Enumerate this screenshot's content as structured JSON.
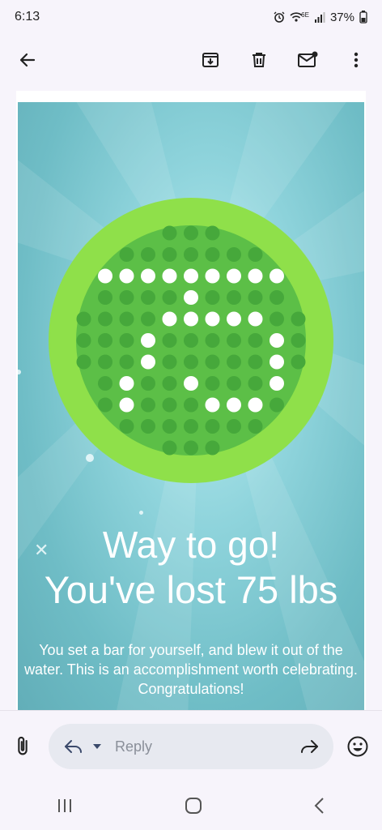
{
  "status": {
    "time": "6:13",
    "network_label": "6E",
    "battery": "37%"
  },
  "toolbar": {
    "back_icon": "arrow-left-icon",
    "archive_icon": "archive-icon",
    "delete_icon": "trash-icon",
    "mark_unread_icon": "mail-unread-icon",
    "more_icon": "more-vert-icon"
  },
  "email": {
    "headline_line1": "Way to go!",
    "headline_line2": "You've lost 75 lbs",
    "body": "You set a bar for yourself, and blew it out of the water. This is an accomplishment worth celebrating. Congratulations!",
    "badge_value": 75,
    "colors": {
      "background": "#7fc8d1",
      "ring": "#8fe04a",
      "medal_inner": "#5cbf47",
      "dots": "#46a83b"
    }
  },
  "compose": {
    "reply_placeholder": "Reply"
  },
  "navigation": {
    "recents_icon": "recents-icon",
    "home_icon": "home-icon",
    "back_icon": "nav-back-icon"
  }
}
